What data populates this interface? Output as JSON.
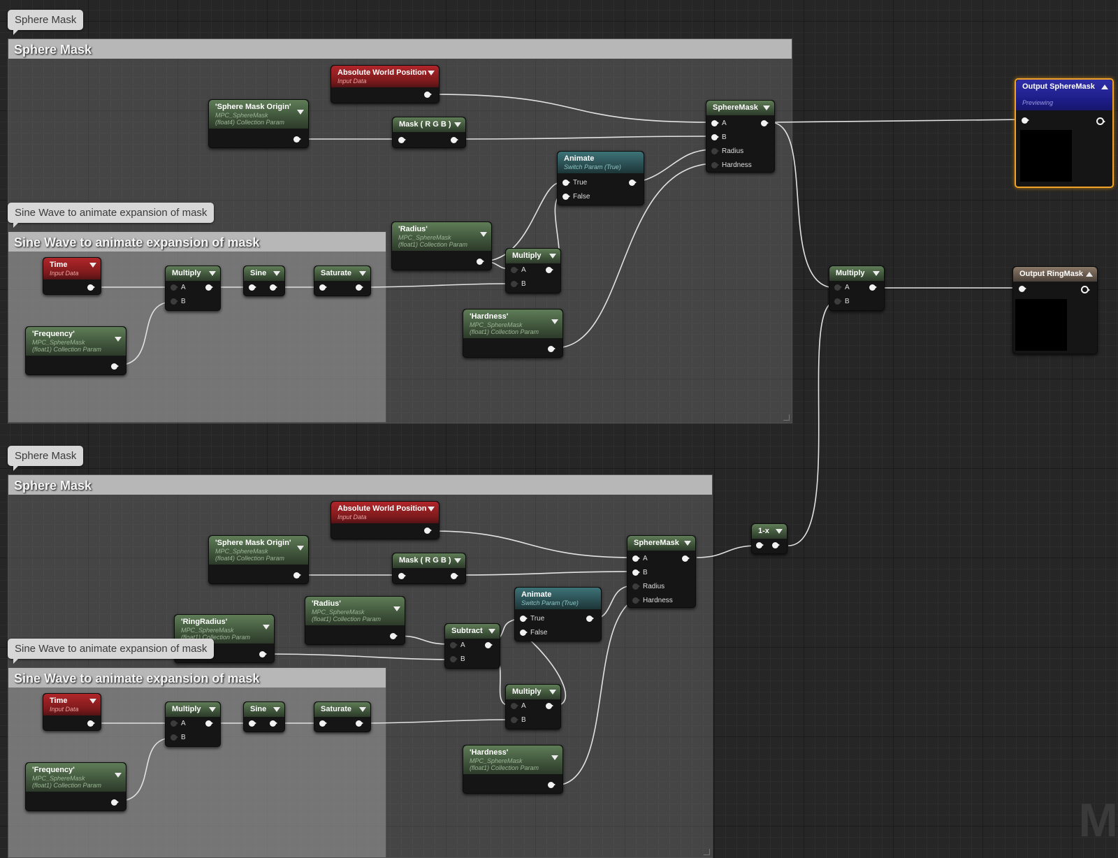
{
  "bubbles": {
    "top_sphere_mask": "Sphere Mask",
    "top_sine_wave": "Sine Wave to animate expansion of mask",
    "bottom_sphere_mask": "Sphere Mask",
    "bottom_sine_wave": "Sine Wave to animate expansion of mask"
  },
  "comments": {
    "top_sphere_mask": "Sphere Mask",
    "top_sine_wave": "Sine Wave to animate expansion of mask",
    "bottom_sphere_mask": "Sphere Mask",
    "bottom_sine_wave": "Sine Wave to animate expansion of mask"
  },
  "pins": {
    "a": "A",
    "b": "B",
    "radius": "Radius",
    "hardness": "Hardness",
    "true": "True",
    "false": "False"
  },
  "top": {
    "abs_world_pos": {
      "title": "Absolute World Position",
      "sub": "Input Data"
    },
    "sphere_origin": {
      "title": "'Sphere Mask Origin'",
      "sub1": "MPC_SphereMask",
      "sub2": "(float4) Collection Param"
    },
    "mask_rgb": {
      "title": "Mask ( R G B )"
    },
    "spheremask": {
      "title": "SphereMask"
    },
    "animate": {
      "title": "Animate",
      "sub": "Switch Param (True)"
    },
    "radius": {
      "title": "'Radius'",
      "sub1": "MPC_SphereMask",
      "sub2": "(float1) Collection Param"
    },
    "multiply_radius": {
      "title": "Multiply"
    },
    "hardness": {
      "title": "'Hardness'",
      "sub1": "MPC_SphereMask",
      "sub2": "(float1) Collection Param"
    },
    "time": {
      "title": "Time",
      "sub": "Input Data"
    },
    "multiply_time": {
      "title": "Multiply"
    },
    "sine": {
      "title": "Sine"
    },
    "saturate": {
      "title": "Saturate"
    },
    "frequency": {
      "title": "'Frequency'",
      "sub1": "MPC_SphereMask",
      "sub2": "(float1) Collection Param"
    }
  },
  "bottom": {
    "abs_world_pos": {
      "title": "Absolute World Position",
      "sub": "Input Data"
    },
    "sphere_origin": {
      "title": "'Sphere Mask Origin'",
      "sub1": "MPC_SphereMask",
      "sub2": "(float4) Collection Param"
    },
    "mask_rgb": {
      "title": "Mask ( R G B )"
    },
    "spheremask": {
      "title": "SphereMask"
    },
    "animate": {
      "title": "Animate",
      "sub": "Switch Param (True)"
    },
    "radius": {
      "title": "'Radius'",
      "sub1": "MPC_SphereMask",
      "sub2": "(float1) Collection Param"
    },
    "ring_radius": {
      "title": "'RingRadius'",
      "sub1": "MPC_SphereMask",
      "sub2": "(float1) Collection Param"
    },
    "subtract": {
      "title": "Subtract"
    },
    "multiply_radius": {
      "title": "Multiply"
    },
    "hardness": {
      "title": "'Hardness'",
      "sub1": "MPC_SphereMask",
      "sub2": "(float1) Collection Param"
    },
    "time": {
      "title": "Time",
      "sub": "Input Data"
    },
    "multiply_time": {
      "title": "Multiply"
    },
    "sine": {
      "title": "Sine"
    },
    "saturate": {
      "title": "Saturate"
    },
    "frequency": {
      "title": "'Frequency'",
      "sub1": "MPC_SphereMask",
      "sub2": "(float1) Collection Param"
    }
  },
  "right": {
    "output_spheremask": {
      "title": "Output SphereMask",
      "sub": "Previewing"
    },
    "multiply": {
      "title": "Multiply"
    },
    "output_ringmask": {
      "title": "Output RingMask"
    },
    "one_minus_x": {
      "title": "1-x"
    }
  },
  "watermark": "M",
  "colors": {
    "param_header": "#4f6a49",
    "input_header": "#9a2022",
    "switch_header": "#31595c",
    "output_header": "#24249a",
    "output_ringmask_header": "#75665a",
    "selection_outline": "#f0a228",
    "wire": "#e2e2e2"
  }
}
